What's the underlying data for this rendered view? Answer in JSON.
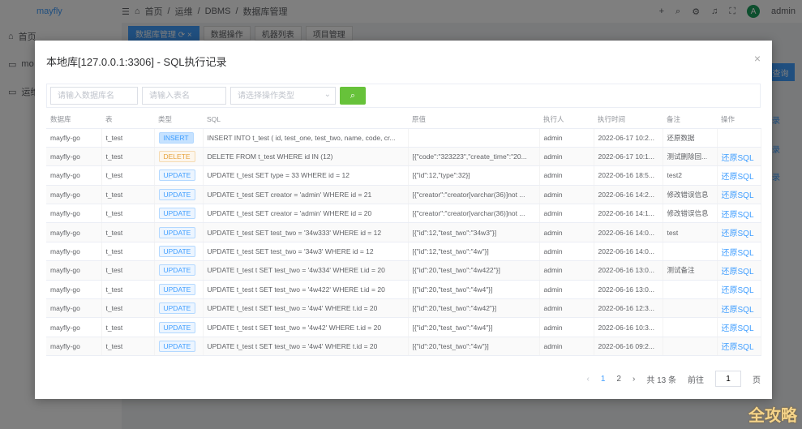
{
  "app": {
    "logo": "mayfly",
    "breadcrumb": [
      "首页",
      "运维",
      "DBMS",
      "数据库管理"
    ],
    "user": "admin",
    "avatar": "A"
  },
  "sidebar": {
    "items": [
      "首页",
      "mo",
      "运维",
      "",
      "",
      "",
      "",
      "",
      "",
      "",
      "系"
    ]
  },
  "tabs": [
    "数据库管理 ⟳ ×",
    "数据操作",
    "机器列表",
    "项目管理"
  ],
  "background": {
    "query_button": "查询",
    "link": "录"
  },
  "modal": {
    "title": "本地库[127.0.0.1:3306] - SQL执行记录",
    "close": "×",
    "filter": {
      "db_placeholder": "请输入数据库名",
      "table_placeholder": "请输入表名",
      "type_placeholder": "请选择操作类型"
    },
    "columns": [
      "数据库",
      "表",
      "类型",
      "SQL",
      "原值",
      "执行人",
      "执行时间",
      "备注",
      "操作"
    ],
    "rows": [
      {
        "db": "mayfly-go",
        "table": "t_test",
        "type": "INSERT",
        "sql": "INSERT INTO t_test ( id, test_one, test_two, name, code, cr...",
        "old": "",
        "user": "admin",
        "time": "2022-06-17 10:2...",
        "remark": "还原数据",
        "action": ""
      },
      {
        "db": "mayfly-go",
        "table": "t_test",
        "type": "DELETE",
        "sql": "DELETE FROM t_test WHERE id IN (12)",
        "old": "[{\"code\":\"323223\",\"create_time\":\"20...",
        "user": "admin",
        "time": "2022-06-17 10:1...",
        "remark": "测试删除回...",
        "action": "还原SQL"
      },
      {
        "db": "mayfly-go",
        "table": "t_test",
        "type": "UPDATE",
        "sql": "UPDATE t_test SET type = 33 WHERE id = 12",
        "old": "[{\"id\":12,\"type\":32}]",
        "user": "admin",
        "time": "2022-06-16 18:5...",
        "remark": "test2",
        "action": "还原SQL"
      },
      {
        "db": "mayfly-go",
        "table": "t_test",
        "type": "UPDATE",
        "sql": "UPDATE t_test SET creator = 'admin' WHERE id = 21",
        "old": "[{\"creator\":\"creator[varchar(36)]not ...",
        "user": "admin",
        "time": "2022-06-16 14:2...",
        "remark": "修改错误信息",
        "action": "还原SQL"
      },
      {
        "db": "mayfly-go",
        "table": "t_test",
        "type": "UPDATE",
        "sql": "UPDATE t_test SET creator = 'admin' WHERE id = 20",
        "old": "[{\"creator\":\"creator[varchar(36)]not ...",
        "user": "admin",
        "time": "2022-06-16 14:1...",
        "remark": "修改错误信息",
        "action": "还原SQL"
      },
      {
        "db": "mayfly-go",
        "table": "t_test",
        "type": "UPDATE",
        "sql": "UPDATE t_test SET test_two = '34w333' WHERE id = 12",
        "old": "[{\"id\":12,\"test_two\":\"34w3\"}]",
        "user": "admin",
        "time": "2022-06-16 14:0...",
        "remark": "test",
        "action": "还原SQL"
      },
      {
        "db": "mayfly-go",
        "table": "t_test",
        "type": "UPDATE",
        "sql": "UPDATE t_test SET test_two = '34w3' WHERE id = 12",
        "old": "[{\"id\":12,\"test_two\":\"4w\"}]",
        "user": "admin",
        "time": "2022-06-16 14:0...",
        "remark": "",
        "action": "还原SQL"
      },
      {
        "db": "mayfly-go",
        "table": "t_test",
        "type": "UPDATE",
        "sql": "UPDATE t_test t SET test_two = '4w334' WHERE t.id = 20",
        "old": "[{\"id\":20,\"test_two\":\"4w422\"}]",
        "user": "admin",
        "time": "2022-06-16 13:0...",
        "remark": "测试备注",
        "action": "还原SQL"
      },
      {
        "db": "mayfly-go",
        "table": "t_test",
        "type": "UPDATE",
        "sql": "UPDATE t_test t SET test_two = '4w422' WHERE t.id = 20",
        "old": "[{\"id\":20,\"test_two\":\"4w4\"}]",
        "user": "admin",
        "time": "2022-06-16 13:0...",
        "remark": "",
        "action": "还原SQL"
      },
      {
        "db": "mayfly-go",
        "table": "t_test",
        "type": "UPDATE",
        "sql": "UPDATE t_test t SET test_two = '4w4' WHERE t.id = 20",
        "old": "[{\"id\":20,\"test_two\":\"4w42\"}]",
        "user": "admin",
        "time": "2022-06-16 12:3...",
        "remark": "",
        "action": "还原SQL"
      },
      {
        "db": "mayfly-go",
        "table": "t_test",
        "type": "UPDATE",
        "sql": "UPDATE t_test t SET test_two = '4w42' WHERE t.id = 20",
        "old": "[{\"id\":20,\"test_two\":\"4w4\"}]",
        "user": "admin",
        "time": "2022-06-16 10:3...",
        "remark": "",
        "action": "还原SQL"
      },
      {
        "db": "mayfly-go",
        "table": "t_test",
        "type": "UPDATE",
        "sql": "UPDATE t_test t SET test_two = '4w4' WHERE t.id = 20",
        "old": "[{\"id\":20,\"test_two\":\"4w\"}]",
        "user": "admin",
        "time": "2022-06-16 09:2...",
        "remark": "",
        "action": "还原SQL"
      }
    ],
    "pagination": {
      "prev": "‹",
      "pages": [
        "1",
        "2"
      ],
      "next": "›",
      "total": "共 13 条",
      "goto": "前往",
      "page_value": "1",
      "page_suffix": "页"
    }
  },
  "watermark": "全攻略"
}
